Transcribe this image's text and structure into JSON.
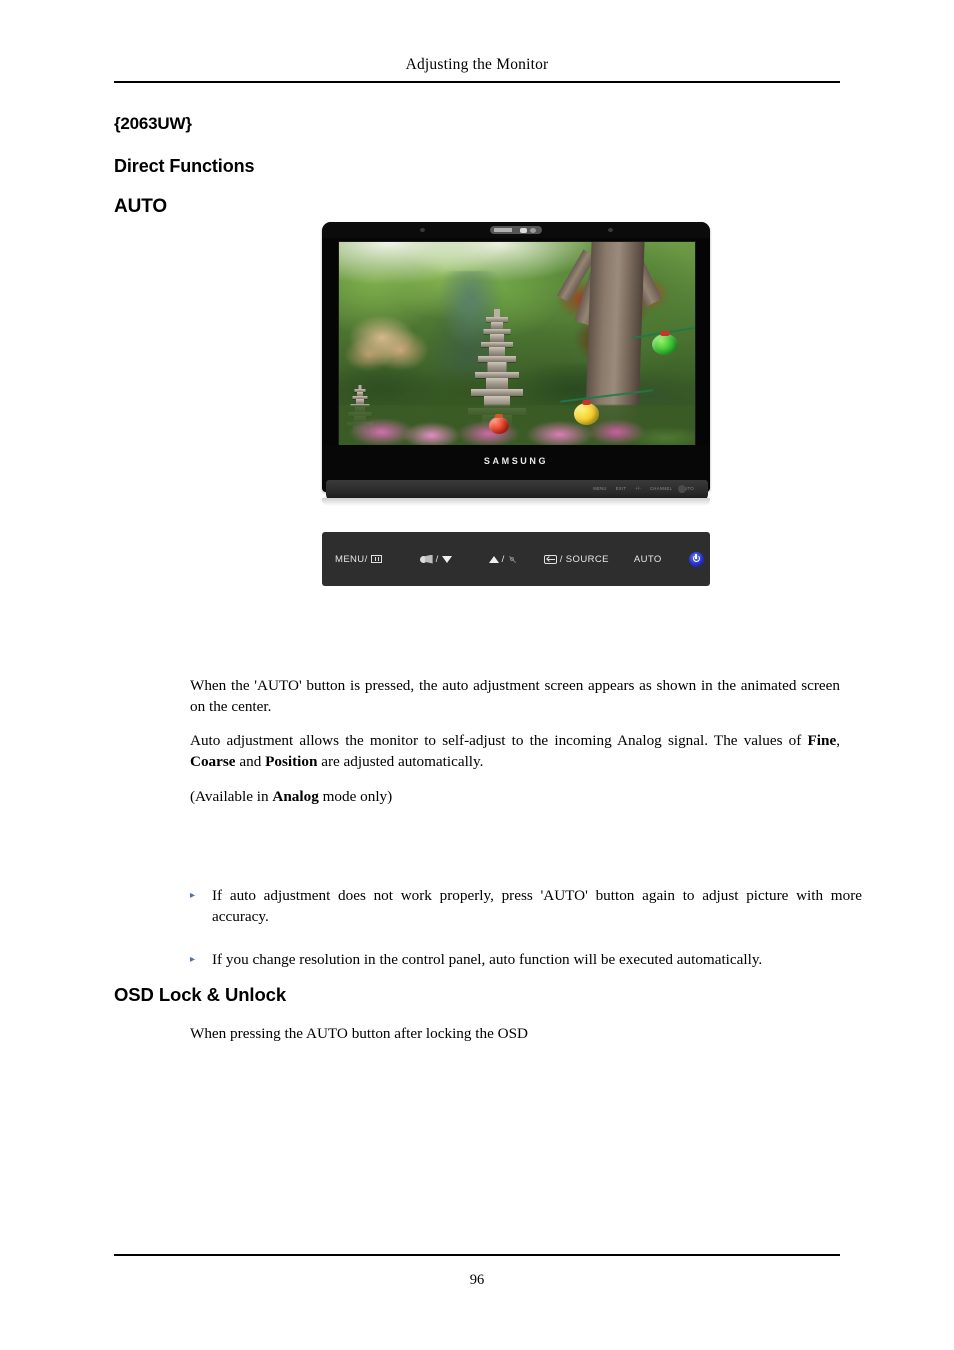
{
  "header": {
    "title": "Adjusting the Monitor"
  },
  "headings": {
    "model": "{2063UW}",
    "section": "Direct Functions",
    "subsection": "AUTO",
    "osd_section": "OSD Lock & Unlock"
  },
  "figure": {
    "brand_logo": "SAMSUNG",
    "stand_labels": [
      "MENU",
      "EXIT",
      "+/-",
      "CHANNEL",
      "AUTO"
    ],
    "buttons": [
      {
        "label": "MENU/",
        "icon": "menu-bars-icon"
      },
      {
        "label": "/",
        "icon": "magic-bright-icon",
        "icon2": "triangle-down-icon"
      },
      {
        "label": "/",
        "icon": "triangle-up-icon",
        "icon2": "brightness-sun-icon"
      },
      {
        "label": "/ SOURCE",
        "icon": "enter-icon"
      },
      {
        "label": "AUTO",
        "icon": ""
      },
      {
        "label": "",
        "icon": "power-icon"
      }
    ],
    "button_labels": {
      "menu": "MENU/",
      "magic": "/",
      "up": "/",
      "source": "/ SOURCE",
      "auto": "AUTO"
    }
  },
  "body": {
    "p1": "When the 'AUTO' button is pressed, the auto adjustment screen appears as shown in the animated screen on the center.",
    "p2_part1": "Auto adjustment allows the monitor to self-adjust to the incoming Analog signal. The values of ",
    "p2_bold1": "Fine",
    "p2_part2": ", ",
    "p2_bold2": "Coarse",
    "p2_part3": " and ",
    "p2_bold3": "Position",
    "p2_part4": " are adjusted automatically.",
    "p3_part1": "(Available in ",
    "p3_bold1": "Analog",
    "p3_part2": " mode only)",
    "note1": "If auto adjustment does not work properly, press 'AUTO' button again to adjust picture with more accuracy.",
    "note2": "If you change resolution in the control panel, auto function will be executed automatically.",
    "osd_text": "When pressing the AUTO button after locking the OSD",
    "bullet_glyph": "▸"
  },
  "footer": {
    "page_number": "96"
  },
  "colors": {
    "bullet": "#53709e",
    "panel_bg": "#2e2e2e",
    "power_blue": "#2230c8"
  }
}
